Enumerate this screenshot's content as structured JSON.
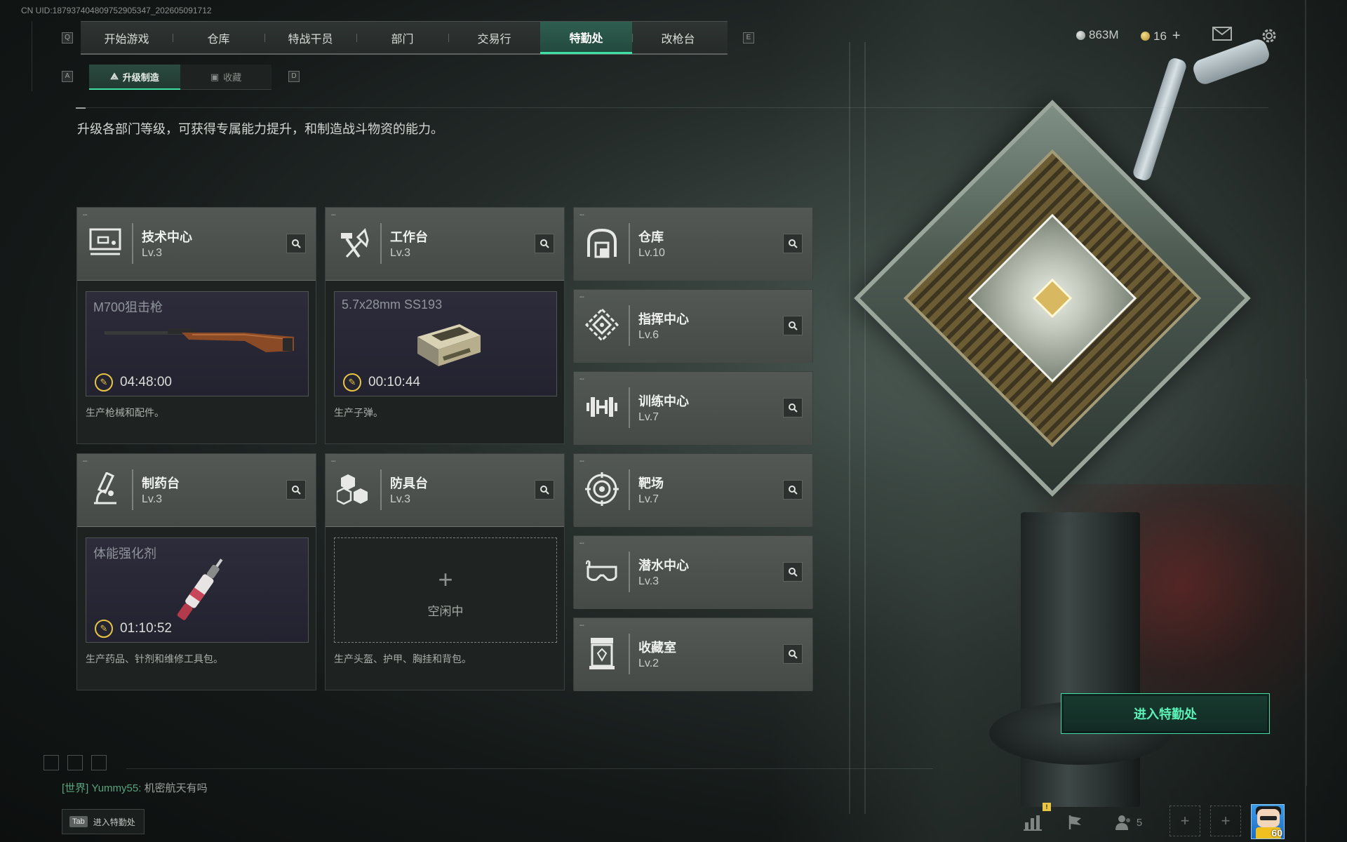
{
  "uid": "CN UID:1879374048097529053​47_202605091712",
  "nav": {
    "key_left": "Q",
    "key_right": "E",
    "tabs": [
      "开始游戏",
      "仓库",
      "特战干员",
      "部门",
      "交易行",
      "特勤处",
      "改枪台"
    ],
    "active": "特勤处"
  },
  "currency": {
    "money": "863M",
    "coins": "16",
    "plus": "+"
  },
  "subnav": {
    "key_left": "A",
    "key_right": "D",
    "tabs": [
      "升级制造",
      "收藏"
    ]
  },
  "description": "升级各部门等级，可获得专属能力提升，和制造战斗物资的能力。",
  "production_depts": [
    {
      "name": "技术中心",
      "level": "Lv.3",
      "icon": "tech-center-icon",
      "product": "M700狙击枪",
      "time": "04:48:00",
      "footer": "生产枪械和配件。",
      "state": "busy"
    },
    {
      "name": "工作台",
      "level": "Lv.3",
      "icon": "workbench-icon",
      "product": "5.7x28mm SS193",
      "time": "00:10:44",
      "footer": "生产子弹。",
      "state": "busy"
    },
    {
      "name": "制药台",
      "level": "Lv.3",
      "icon": "pharmacy-icon",
      "product": "体能强化剂",
      "time": "01:10:52",
      "footer": "生产药品、针剂和维修工具包。",
      "state": "busy"
    },
    {
      "name": "防具台",
      "level": "Lv.3",
      "icon": "armor-bench-icon",
      "product": "",
      "time": "",
      "footer": "生产头盔、护甲、胸挂和背包。",
      "state": "idle",
      "idle_label": "空闲中"
    }
  ],
  "other_depts": [
    {
      "name": "仓库",
      "level": "Lv.10",
      "icon": "warehouse-icon"
    },
    {
      "name": "指挥中心",
      "level": "Lv.6",
      "icon": "command-center-icon"
    },
    {
      "name": "训练中心",
      "level": "Lv.7",
      "icon": "training-center-icon"
    },
    {
      "name": "靶场",
      "level": "Lv.7",
      "icon": "shooting-range-icon"
    },
    {
      "name": "潜水中心",
      "level": "Lv.3",
      "icon": "diving-center-icon"
    },
    {
      "name": "收藏室",
      "level": "Lv.2",
      "icon": "collection-room-icon"
    }
  ],
  "enter_button": "进入特勤处",
  "chat": {
    "channel": "[世界]",
    "sender": "Yummy55:",
    "message": "机密航天有吗"
  },
  "tab_hint": {
    "key": "Tab",
    "label": "进入特勤处"
  },
  "bottom_bar": {
    "friends_count": "5",
    "player_level": "60",
    "alert": "!"
  },
  "colors": {
    "accent": "#3fe0a6",
    "timer": "#e8c545",
    "chat_channel": "#58a47d"
  }
}
